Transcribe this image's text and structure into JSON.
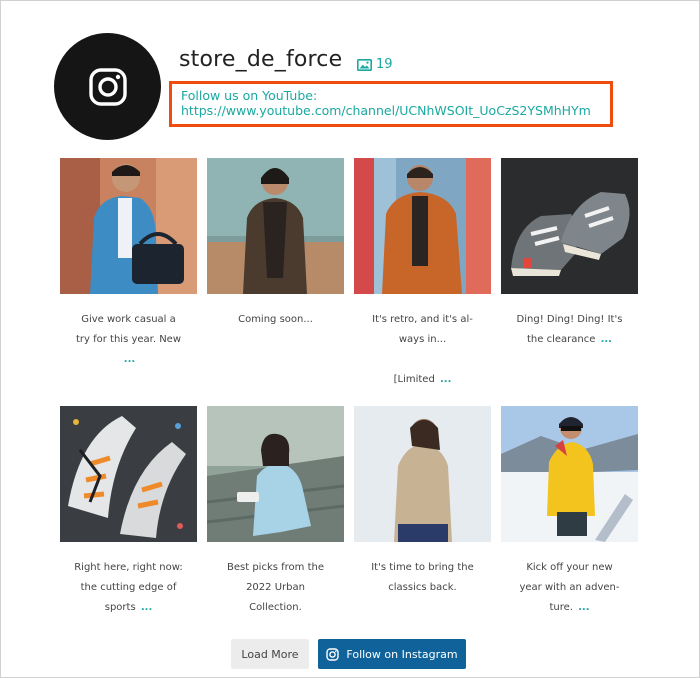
{
  "header": {
    "username": "store_de_force",
    "post_count": "19",
    "bio_line1": "Follow us on YouTube:",
    "bio_line2": "https://www.youtube.com/channel/UCNhWSOIt_UoCzS2YSMhHYm"
  },
  "posts": [
    {
      "line1": "Give work casual a",
      "line2": "try for this year. New",
      "line3": "",
      "more": "...",
      "photo": "man-blue-suit-bag"
    },
    {
      "line1": "Coming soon...",
      "line2": "",
      "line3": "",
      "more": "",
      "photo": "man-brown-jacket-desert"
    },
    {
      "line1": "It's retro, and it's al-",
      "line2": "ways in...",
      "line3": "[Limited",
      "more": "...",
      "photo": "man-orange-jacket-graffiti"
    },
    {
      "line1": "Ding! Ding! Ding! It's",
      "line2": "the clearance",
      "line3": "",
      "more": "...",
      "photo": "grey-sneakers"
    },
    {
      "line1": "Right here, right now:",
      "line2": "the cutting edge of",
      "line3": "sports",
      "more": "...",
      "photo": "orange-sneakers-dark"
    },
    {
      "line1": "Best picks from the",
      "line2": "2022 Urban",
      "line3": "Collection.",
      "more": "",
      "photo": "woman-sitting-stairs"
    },
    {
      "line1": "It's time to bring the",
      "line2": "classics back.",
      "line3": "",
      "more": "",
      "photo": "woman-beige-coat"
    },
    {
      "line1": "Kick off your new",
      "line2": "year with an adven-",
      "line3": "ture.",
      "more": "...",
      "photo": "man-yellow-jacket-snow"
    }
  ],
  "buttons": {
    "load_more": "Load More",
    "follow": "Follow on Instagram"
  },
  "colors": {
    "accent_teal": "#1aa8a0",
    "highlight_orange": "#ef4d0e",
    "follow_button": "#10639a"
  }
}
